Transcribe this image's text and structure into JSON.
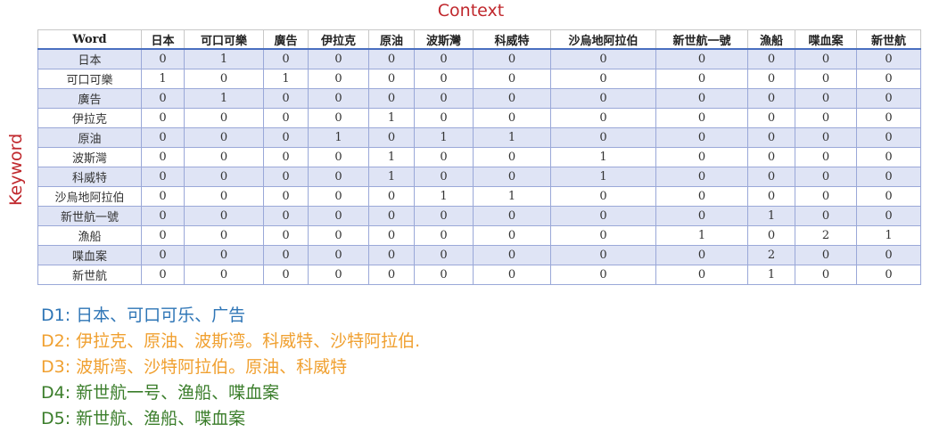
{
  "labels": {
    "context": "Context",
    "keyword": "Keyword"
  },
  "table": {
    "headers": [
      "Word",
      "日本",
      "可口可樂",
      "廣告",
      "伊拉克",
      "原油",
      "波斯灣",
      "科威特",
      "沙烏地阿拉伯",
      "新世航一號",
      "漁船",
      "喋血案",
      "新世航"
    ],
    "rows": [
      [
        "日本",
        "0",
        "1",
        "0",
        "0",
        "0",
        "0",
        "0",
        "0",
        "0",
        "0",
        "0",
        "0"
      ],
      [
        "可口可樂",
        "1",
        "0",
        "1",
        "0",
        "0",
        "0",
        "0",
        "0",
        "0",
        "0",
        "0",
        "0"
      ],
      [
        "廣告",
        "0",
        "1",
        "0",
        "0",
        "0",
        "0",
        "0",
        "0",
        "0",
        "0",
        "0",
        "0"
      ],
      [
        "伊拉克",
        "0",
        "0",
        "0",
        "0",
        "1",
        "0",
        "0",
        "0",
        "0",
        "0",
        "0",
        "0"
      ],
      [
        "原油",
        "0",
        "0",
        "0",
        "1",
        "0",
        "1",
        "1",
        "0",
        "0",
        "0",
        "0",
        "0"
      ],
      [
        "波斯灣",
        "0",
        "0",
        "0",
        "0",
        "1",
        "0",
        "0",
        "1",
        "0",
        "0",
        "0",
        "0"
      ],
      [
        "科威特",
        "0",
        "0",
        "0",
        "0",
        "1",
        "0",
        "0",
        "1",
        "0",
        "0",
        "0",
        "0"
      ],
      [
        "沙烏地阿拉伯",
        "0",
        "0",
        "0",
        "0",
        "0",
        "1",
        "1",
        "0",
        "0",
        "0",
        "0",
        "0"
      ],
      [
        "新世航一號",
        "0",
        "0",
        "0",
        "0",
        "0",
        "0",
        "0",
        "0",
        "0",
        "1",
        "0",
        "0"
      ],
      [
        "漁船",
        "0",
        "0",
        "0",
        "0",
        "0",
        "0",
        "0",
        "0",
        "1",
        "0",
        "2",
        "1"
      ],
      [
        "喋血案",
        "0",
        "0",
        "0",
        "0",
        "0",
        "0",
        "0",
        "0",
        "0",
        "2",
        "0",
        "0"
      ],
      [
        "新世航",
        "0",
        "0",
        "0",
        "0",
        "0",
        "0",
        "0",
        "0",
        "0",
        "1",
        "0",
        "0"
      ]
    ]
  },
  "documents": [
    "D1: 日本、可口可乐、广告",
    "D2: 伊拉克、原油、波斯湾。科威特、沙特阿拉伯.",
    "D3: 波斯湾、沙特阿拉伯。原油、科威特",
    "D4: 新世航一号、渔船、喋血案",
    "D5: 新世航、渔船、喋血案"
  ],
  "colors": {
    "title": "#c0282d",
    "d1": "#2e75b6",
    "d2_d3": "#f0a030",
    "d4_d5": "#3a7d2a"
  }
}
